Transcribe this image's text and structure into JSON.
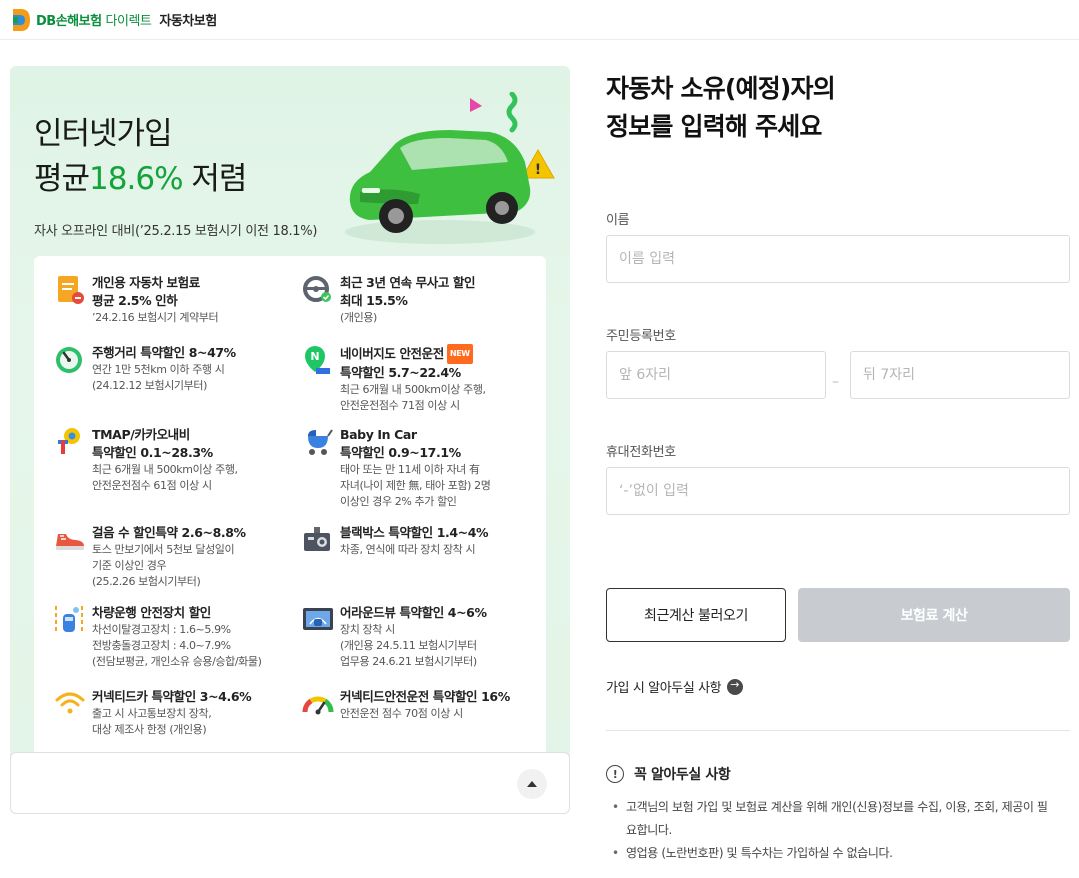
{
  "header": {
    "brand": "DB손해보험",
    "brand_sub": "다이렉트",
    "product": "자동차보험"
  },
  "promo": {
    "title_line1": "인터넷가입",
    "title_prefix": "평균",
    "title_highlight": "18.6%",
    "title_suffix": " 저렴",
    "description": "자사 오프라인 대비(’25.2.15 보험시기 이전 18.1%)",
    "benefits": [
      {
        "title": "개인용 자동차 보험료",
        "title2": "평균 2.5% 인하",
        "desc": [
          "’24.2.16 보험시기 계약부터"
        ],
        "icon": "document-icon"
      },
      {
        "title": "최근 3년 연속 무사고 할인",
        "title2": "최대 15.5%",
        "desc": [
          "(개인용)"
        ],
        "icon": "steering-wheel-icon"
      },
      {
        "title": "주행거리 특약할인 8~47%",
        "title2": "",
        "desc": [
          "연간 1만 5천km 이하 주행 시",
          "(24.12.12 보험시기부터)"
        ],
        "icon": "gauge-icon"
      },
      {
        "title": "네이버지도 안전운전",
        "badge": "NEW",
        "title2": "특약할인 5.7~22.4%",
        "desc": [
          "최근 6개월 내 500km이상 주행,",
          "안전운전점수 71점 이상 시"
        ],
        "icon": "naver-map-icon"
      },
      {
        "title": "TMAP/카카오내비",
        "title2": "특약할인 0.1~28.3%",
        "desc": [
          "최근 6개월 내 500km이상 주행,",
          "안전운전점수 61점 이상 시"
        ],
        "icon": "navigation-icon"
      },
      {
        "title": "Baby In Car",
        "title2": "특약할인 0.9~17.1%",
        "desc": [
          "태아 또는 만 11세 이하 자녀 有",
          "자녀(나이 제한 無, 태아 포함) 2명",
          "이상인 경우 2% 추가 할인"
        ],
        "icon": "stroller-icon"
      },
      {
        "title": "걸음 수 할인특약 2.6~8.8%",
        "title2": "",
        "desc": [
          "토스 만보기에서 5천보 달성일이",
          "기준 이상인 경우",
          "(25.2.26 보험시기부터)"
        ],
        "icon": "sneaker-icon"
      },
      {
        "title": "블랙박스 특약할인 1.4~4%",
        "title2": "",
        "desc": [
          "차종, 연식에 따라 장치 장착 시"
        ],
        "icon": "dashcam-icon"
      },
      {
        "title": "차량운행 안전장치 할인",
        "title2": "",
        "desc": [
          "차선이탈경고장치 : 1.6~5.9%",
          "전방충돌경고장치 : 4.0~7.9%",
          "(전담보평균, 개인소유 승용/승합/화물)"
        ],
        "icon": "lane-warning-icon"
      },
      {
        "title": "어라운드뷰 특약할인 4~6%",
        "title2": "",
        "desc": [
          "장치 장착 시",
          "(개인용 24.5.11 보험시기부터",
          " 업무용 24.6.21 보험시기부터)"
        ],
        "icon": "around-view-icon"
      },
      {
        "title": "커넥티드카 특약할인 3~4.6%",
        "title2": "",
        "desc": [
          "출고 시 사고통보장치 장착,",
          "대상 제조사 한정 (개인용)"
        ],
        "icon": "wifi-icon"
      },
      {
        "title": "커넥티드안전운전 특약할인 16%",
        "title2": "",
        "desc": [
          "안전운전 점수 70점 이상 시"
        ],
        "icon": "score-gauge-icon"
      }
    ]
  },
  "form": {
    "title_line1": "자동차 소유(예정)자의",
    "title_line2": "정보를 입력해 주세요",
    "name_label": "이름",
    "name_placeholder": "이름 입력",
    "rrn_label": "주민등록번호",
    "rrn_front_placeholder": "앞 6자리",
    "rrn_sep": "–",
    "rrn_back_placeholder": "뒤 7자리",
    "phone_label": "휴대전화번호",
    "phone_placeholder": "‘-’없이 입력",
    "recent_button": "최근계산 불러오기",
    "calc_button": "보험료 계산",
    "notice_link": "가입 시 알아두실 사항",
    "must_title": "꼭 알아두실 사항",
    "must_items": [
      "고객님의 보험 가입 및 보험료 계산을 위해 개인(신용)정보를 수집, 이용, 조회, 제공이 필요합니다.",
      "영업용 (노란번호판) 및 특수차는 가입하실 수 없습니다."
    ]
  },
  "colors": {
    "brand_green": "#14a33a",
    "disabled_button": "#c8ccd1",
    "new_badge": "#ff6a1f"
  }
}
